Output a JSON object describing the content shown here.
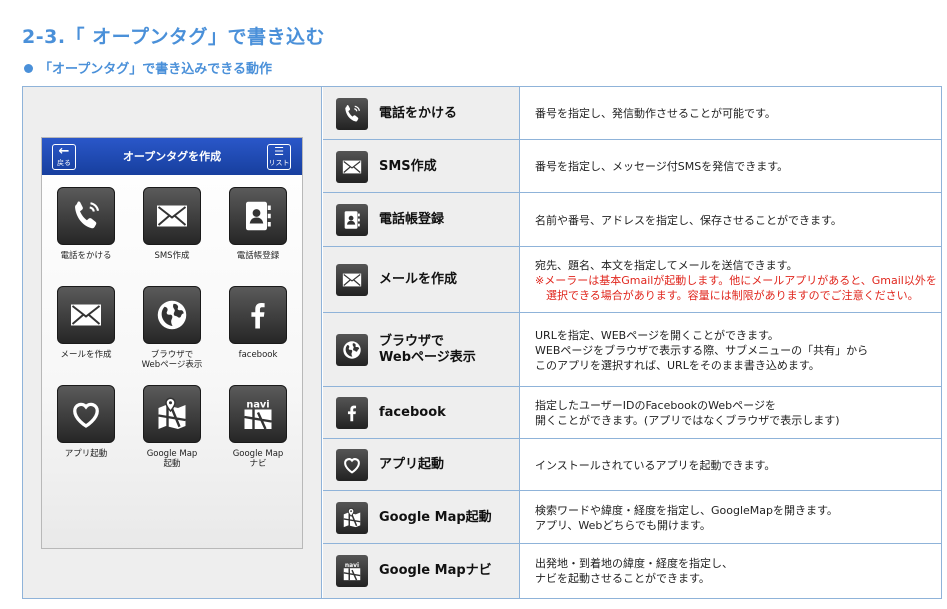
{
  "heading": "2-3.「 オープンタグ」で書き込む",
  "subheading": "「オープンタグ」で書き込みできる動作",
  "phone": {
    "back_label": "戻る",
    "back_arrow": "←",
    "title": "オープンタグを作成",
    "list_label": "リスト",
    "apps": [
      {
        "label": "電話をかける",
        "icon": "phone-icon"
      },
      {
        "label": "SMS作成",
        "icon": "envelope-icon"
      },
      {
        "label": "電話帳登録",
        "icon": "address-book-icon"
      },
      {
        "label": "メールを作成",
        "icon": "envelope-icon"
      },
      {
        "label": "ブラウザで\nWebページ表示",
        "icon": "globe-icon"
      },
      {
        "label": "facebook",
        "icon": "facebook-icon"
      },
      {
        "label": "アプリ起動",
        "icon": "heart-icon"
      },
      {
        "label": "Google Map\n起動",
        "icon": "map-icon"
      },
      {
        "label": "Google Map\nナビ",
        "icon": "navi-icon"
      }
    ],
    "navi_text": "navi"
  },
  "rows": [
    {
      "name": "電話をかける",
      "icon": "phone-icon",
      "desc": [
        "番号を指定し、発信動作させることが可能です。"
      ],
      "note": []
    },
    {
      "name": "SMS作成",
      "icon": "envelope-icon",
      "desc": [
        "番号を指定し、メッセージ付SMSを発信できます。"
      ],
      "note": []
    },
    {
      "name": "電話帳登録",
      "icon": "address-book-icon",
      "desc": [
        "名前や番号、アドレスを指定し、保存させることができます。"
      ],
      "note": []
    },
    {
      "name": "メールを作成",
      "icon": "envelope-icon",
      "desc": [
        "宛先、題名、本文を指定してメールを送信できます。"
      ],
      "note": [
        "※メーラーは基本Gmailが起動します。他にメールアプリがあると、Gmail以外を",
        "　選択できる場合があります。容量には制限がありますのでご注意ください。"
      ]
    },
    {
      "name": "ブラウザで\nWebページ表示",
      "icon": "globe-icon",
      "desc": [
        "URLを指定、WEBページを開くことができます。",
        "WEBページをブラウザで表示する際、サブメニューの「共有」から",
        "このアプリを選択すれば、URLをそのまま書き込めます。"
      ],
      "note": []
    },
    {
      "name": "facebook",
      "icon": "facebook-icon",
      "desc": [
        "指定したユーザーIDのFacebookのWebページを",
        "開くことができます。(アプリではなくブラウザで表示します)"
      ],
      "note": []
    },
    {
      "name": "アプリ起動",
      "icon": "heart-icon",
      "desc": [
        "インストールされているアプリを起動できます。"
      ],
      "note": []
    },
    {
      "name": "Google Map起動",
      "icon": "map-icon",
      "desc": [
        "検索ワードや緯度・経度を指定し、GoogleMapを開きます。",
        "アプリ、Webどちらでも開けます。"
      ],
      "note": []
    },
    {
      "name": "Google Mapナビ",
      "icon": "navi-icon",
      "desc": [
        "出発地・到着地の緯度・経度を指定し、",
        "ナビを起動させることができます。"
      ],
      "note": []
    }
  ],
  "colors": {
    "accent": "#4a90d9",
    "border": "#8fb3d9",
    "note_red": "#e0261d",
    "phone_bar": "#1f4bb5"
  }
}
